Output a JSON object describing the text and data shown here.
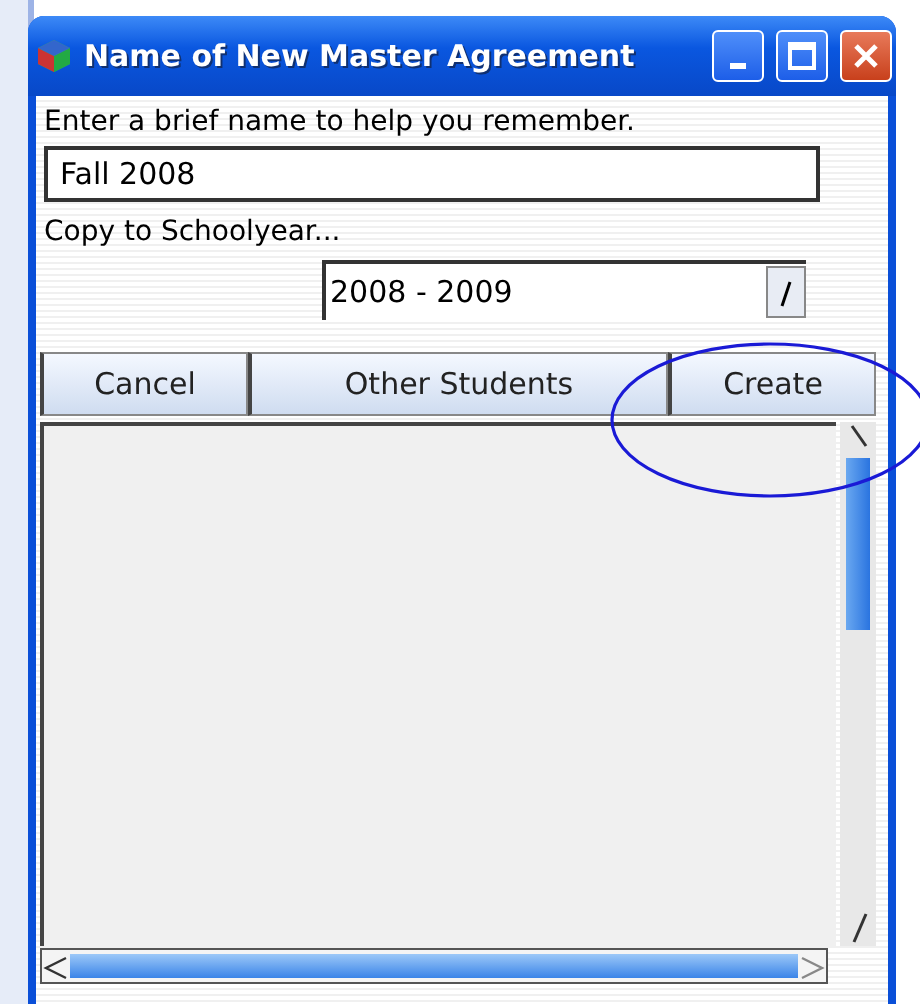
{
  "window": {
    "title": "Name of New Master Agreement"
  },
  "prompt": "Enter a brief name to help you remember.",
  "name_field": {
    "value": "Fall 2008"
  },
  "copy_label": "Copy to Schoolyear...",
  "schoolyear_dropdown": {
    "value": "2008 - 2009"
  },
  "buttons": [
    {
      "label": "Cancel"
    },
    {
      "label": "Other Students"
    },
    {
      "label": "Create"
    }
  ]
}
